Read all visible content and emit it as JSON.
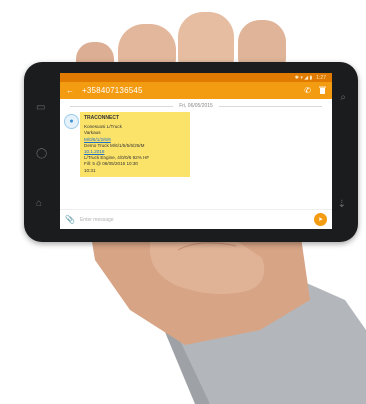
{
  "status_bar": {
    "icons": "✱ ▾ ◢ ▮",
    "time": "1:27"
  },
  "app_bar": {
    "back_icon": "←",
    "phone_number": "+358407136545",
    "call_icon": "✆",
    "delete_icon": "🗑"
  },
  "thread": {
    "date": "Fri, 06/05/2015",
    "message": {
      "sender": "TRACONNECT",
      "lines": [
        "Konesuosi L/Truck",
        "Varkaus",
        "M/0/6/1/2/6/6",
        "Demo Truck M/6/1/5/5/6/25/M",
        "10.1.2018",
        "L/Truck Engine, 4/0/0/6 92% HF",
        "Fill: 5 @ 06/05/2015 10:30",
        "10:31"
      ]
    }
  },
  "composer": {
    "placeholder": "Enter message",
    "attach_icon": "📎",
    "send_icon": "➤"
  },
  "colors": {
    "accent": "#f39c12",
    "accent_dark": "#e07b00",
    "bubble": "#fbe36a"
  }
}
